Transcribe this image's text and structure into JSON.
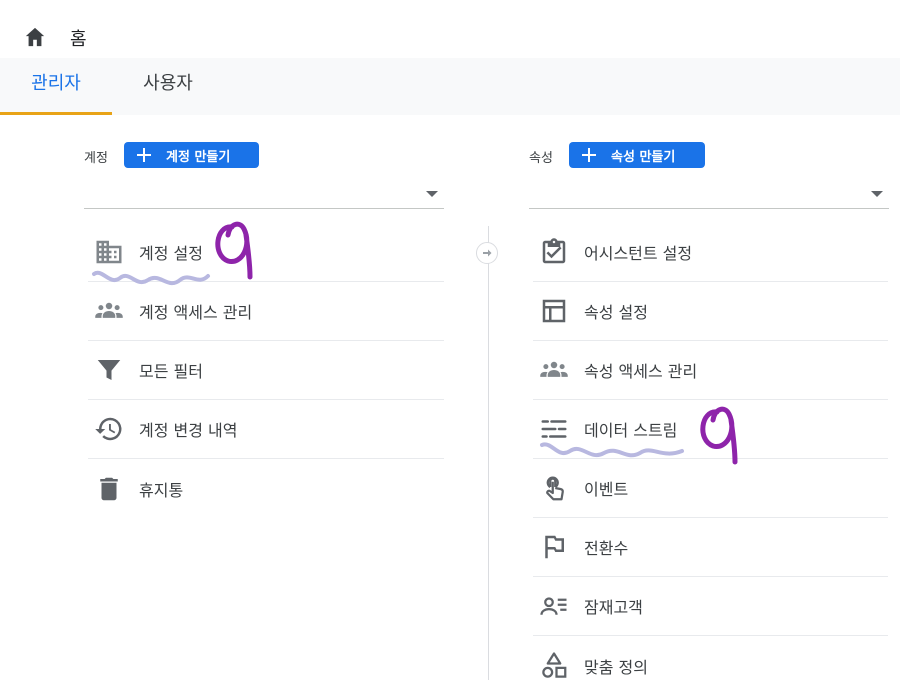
{
  "header": {
    "home_label": "홈"
  },
  "tabs": [
    {
      "label": "관리자",
      "active": true
    },
    {
      "label": "사용자",
      "active": false
    }
  ],
  "account": {
    "heading": "계정",
    "create_button": "계정 만들기",
    "selected_value": "",
    "items": [
      {
        "icon": "building-icon",
        "label": "계정 설정"
      },
      {
        "icon": "people-icon",
        "label": "계정 액세스 관리"
      },
      {
        "icon": "filter-icon",
        "label": "모든 필터"
      },
      {
        "icon": "history-icon",
        "label": "계정 변경 내역"
      },
      {
        "icon": "trash-icon",
        "label": "휴지통"
      }
    ]
  },
  "property": {
    "heading": "속성",
    "create_button": "속성 만들기",
    "selected_value": "",
    "items": [
      {
        "icon": "clipboard-check-icon",
        "label": "어시스턴트 설정"
      },
      {
        "icon": "layout-icon",
        "label": "속성 설정"
      },
      {
        "icon": "people-icon",
        "label": "속성 액세스 관리"
      },
      {
        "icon": "data-streams-icon",
        "label": "데이터 스트림"
      },
      {
        "icon": "touch-icon",
        "label": "이벤트"
      },
      {
        "icon": "flag-icon",
        "label": "전환수"
      },
      {
        "icon": "audience-icon",
        "label": "잠재고객"
      },
      {
        "icon": "shapes-icon",
        "label": "맞춤 정의"
      }
    ]
  },
  "colors": {
    "accent": "#1a73e8",
    "tab_indicator": "#e8a317",
    "icon_gray": "#5f6368",
    "annotation_purple": "#8e24aa"
  }
}
